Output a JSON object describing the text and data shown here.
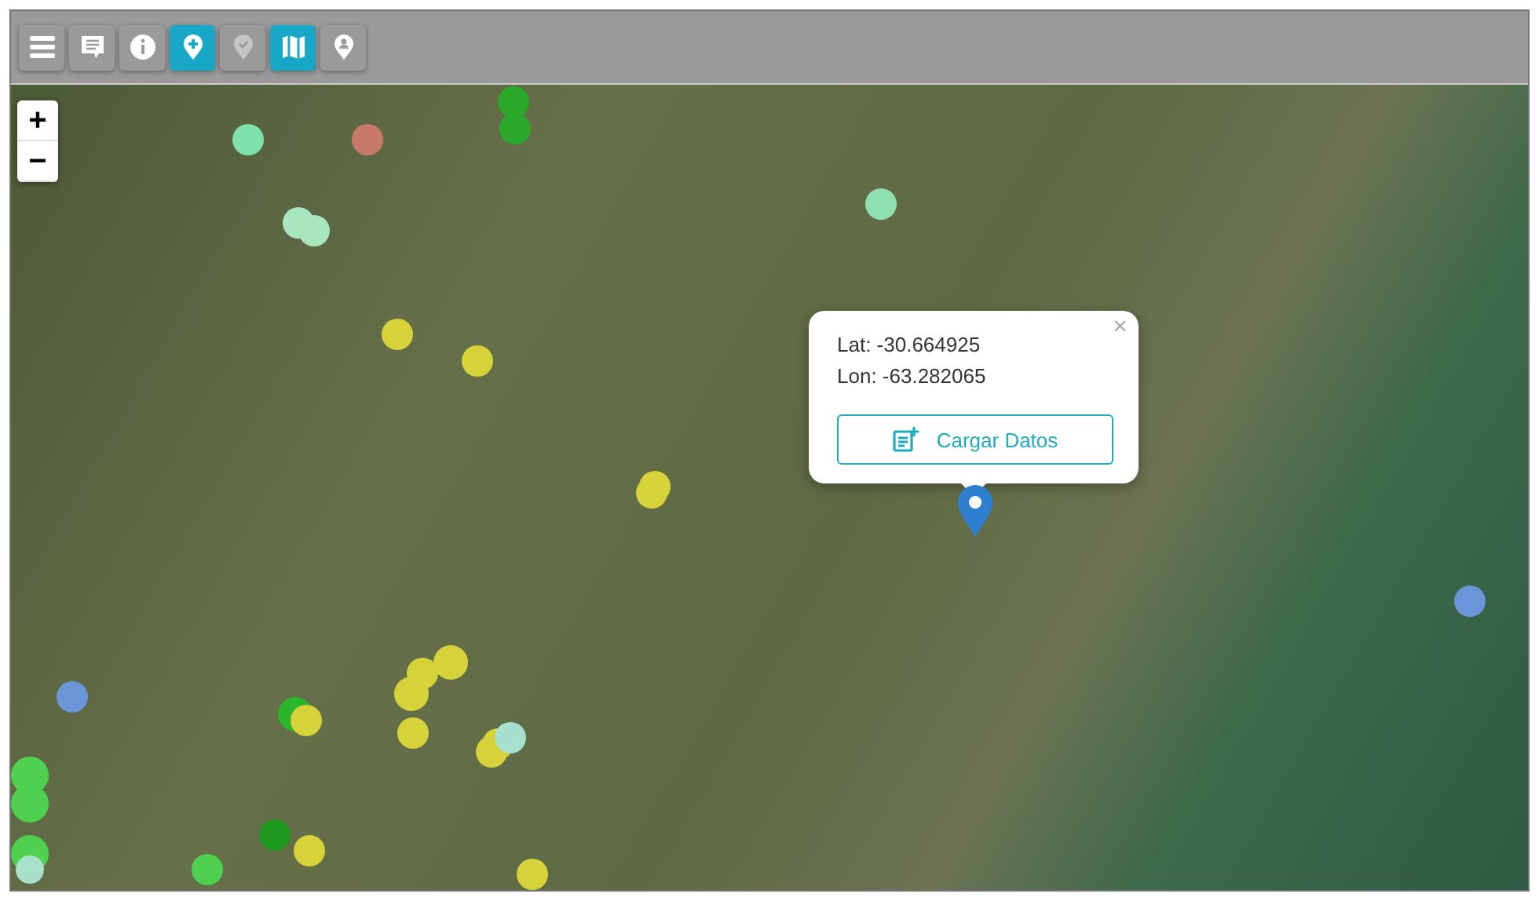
{
  "toolbar": {
    "buttons": [
      {
        "kind": "menu",
        "selected": false,
        "disabled": false
      },
      {
        "kind": "comment",
        "selected": false,
        "disabled": false
      },
      {
        "kind": "info",
        "selected": false,
        "disabled": false
      },
      {
        "kind": "pin-plus",
        "selected": true,
        "disabled": false
      },
      {
        "kind": "pin-check",
        "selected": false,
        "disabled": true
      },
      {
        "kind": "map",
        "selected": true,
        "disabled": false
      },
      {
        "kind": "pin-person",
        "selected": false,
        "disabled": false
      }
    ]
  },
  "zoom_controls": {
    "zoom_in": "+",
    "zoom_out": "−"
  },
  "map": {
    "markers": [
      {
        "color": "#7ee0aa"
      },
      {
        "color": "#c9796a"
      },
      {
        "color": "#2aa82a"
      },
      {
        "color": "#2aa82a"
      },
      {
        "color": "#a8e6c0"
      },
      {
        "color": "#a8e6c0"
      },
      {
        "color": "#8fe0b0"
      },
      {
        "color": "#d6d23a"
      },
      {
        "color": "#d6d23a"
      },
      {
        "color": "#d6d23a"
      },
      {
        "color": "#d6d23a"
      },
      {
        "color": "#d6d23a"
      },
      {
        "color": "#d6d23a"
      },
      {
        "color": "#d6d23a"
      },
      {
        "color": "#d6d23a"
      },
      {
        "color": "#d6d23a"
      },
      {
        "color": "#d6d23a"
      },
      {
        "color": "#a8e0d0"
      },
      {
        "color": "#2ab52a"
      },
      {
        "color": "#d6d23a"
      },
      {
        "color": "#1f9a1f"
      },
      {
        "color": "#d6d23a"
      },
      {
        "color": "#d6d23a"
      },
      {
        "color": "#6a95d8"
      },
      {
        "color": "#6a95d8"
      },
      {
        "color": "#4fd04f"
      },
      {
        "color": "#4fd04f"
      },
      {
        "color": "#4fd04f"
      },
      {
        "color": "#4fd04f"
      },
      {
        "color": "#a8e0c8"
      }
    ]
  },
  "popup": {
    "close": "×",
    "lat": "Lat: -30.664925",
    "lon": "Lon: -63.282065",
    "button": "Cargar Datos"
  }
}
